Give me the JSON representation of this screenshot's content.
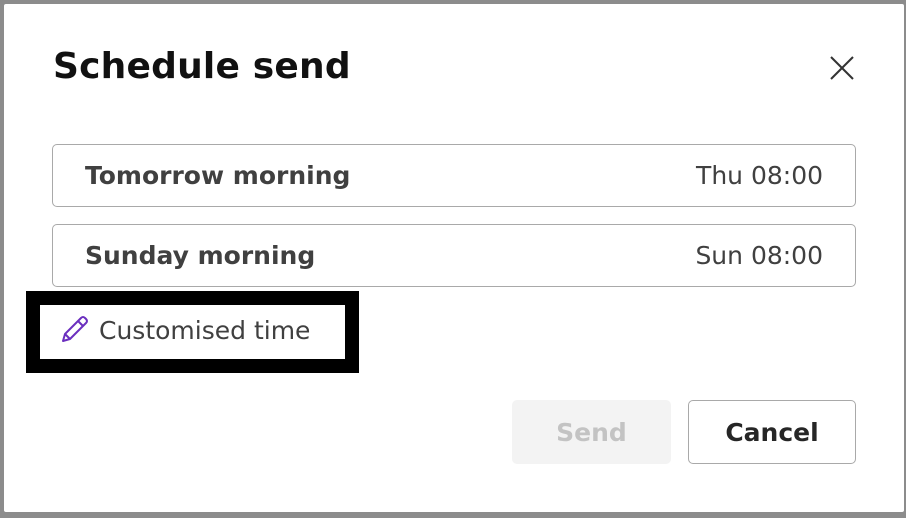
{
  "dialog": {
    "title": "Schedule send",
    "close_icon": "close-icon"
  },
  "options": [
    {
      "label": "Tomorrow morning",
      "time": "Thu 08:00"
    },
    {
      "label": "Sunday morning",
      "time": "Sun 08:00"
    }
  ],
  "custom": {
    "label": "Customised time",
    "icon": "pencil-icon"
  },
  "buttons": {
    "send_label": "Send",
    "cancel_label": "Cancel"
  },
  "colors": {
    "accent": "#6b2fbf",
    "disabled_bg": "#f3f3f3",
    "disabled_text": "#c3c3c3",
    "highlight_border": "#000000"
  }
}
